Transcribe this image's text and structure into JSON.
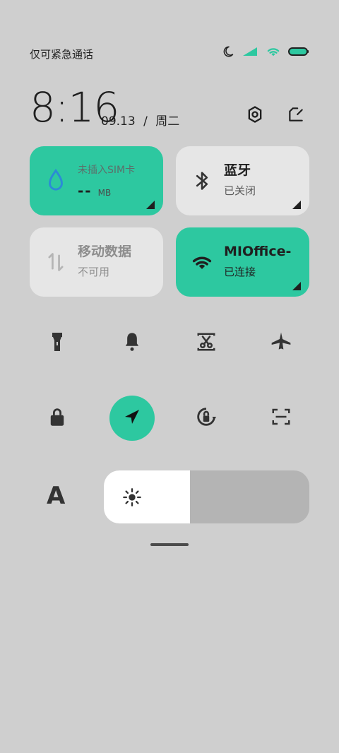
{
  "status_bar": {
    "left_text": "仅可紧急通话",
    "icons": [
      "moon-icon",
      "signal-icon",
      "wifi-icon",
      "battery-icon"
    ],
    "accent_color": "#2dc8a0"
  },
  "header": {
    "time": "8:16",
    "date": "09.13",
    "separator": "/",
    "weekday": "周二",
    "icons": [
      "settings-icon",
      "edit-icon"
    ]
  },
  "tiles": [
    {
      "id": "sim",
      "label": "未插入SIM卡",
      "value": "--",
      "unit": "MB",
      "icon": "water-drop-icon",
      "state": "on"
    },
    {
      "id": "bluetooth",
      "label": "蓝牙",
      "sub": "已关闭",
      "icon": "bluetooth-icon",
      "state": "off"
    },
    {
      "id": "mobile-data",
      "label": "移动数据",
      "sub": "不可用",
      "icon": "data-arrows-icon",
      "state": "disabled"
    },
    {
      "id": "wifi",
      "label": "MIOffice-",
      "sub": "已连接",
      "icon": "wifi-icon",
      "state": "on"
    }
  ],
  "toggles": [
    {
      "name": "flashlight",
      "icon": "flashlight-icon",
      "state": "off"
    },
    {
      "name": "bell",
      "icon": "bell-icon",
      "state": "off"
    },
    {
      "name": "screenshot",
      "icon": "scissors-icon",
      "state": "off"
    },
    {
      "name": "airplane",
      "icon": "airplane-icon",
      "state": "off"
    },
    {
      "name": "lock",
      "icon": "lock-icon",
      "state": "off"
    },
    {
      "name": "location",
      "icon": "location-arrow-icon",
      "state": "on"
    },
    {
      "name": "rotation-lock",
      "icon": "rotate-lock-icon",
      "state": "off"
    },
    {
      "name": "scan",
      "icon": "scan-icon",
      "state": "off"
    }
  ],
  "brightness": {
    "auto_label": "A",
    "level_percent": 42
  }
}
